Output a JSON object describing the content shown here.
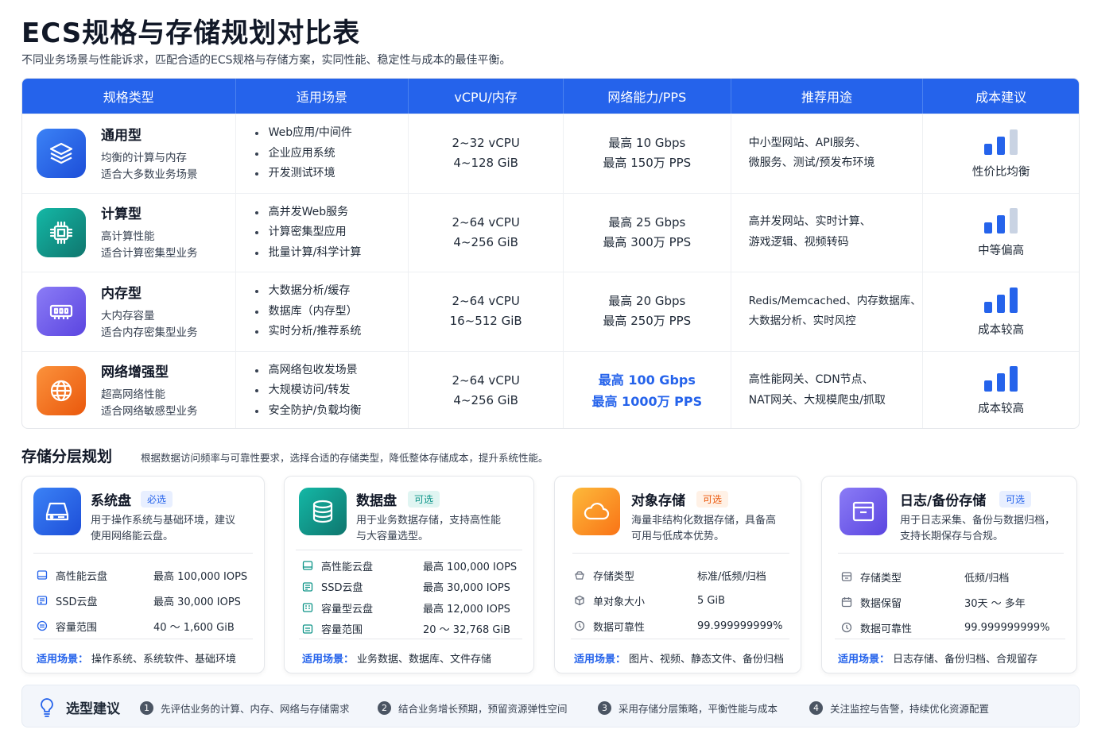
{
  "page": {
    "title": "ECS规格与存储规划对比表",
    "subtitle": "不同业务场景与性能诉求，匹配合适的ECS规格与存储方案，实同性能、稳定性与成本的最佳平衡。"
  },
  "spec_table": {
    "headers": [
      "规格类型",
      "适用场景",
      "vCPU/内存",
      "网络能力/PPS",
      "推荐用途",
      "成本建议"
    ],
    "rows": [
      {
        "name": "通用型",
        "desc": [
          "均衡的计算与内存",
          "适合大多数业务场景"
        ],
        "icon": "layers-icon",
        "icon_color": "#2563eb",
        "scenarios": [
          "Web应用/中间件",
          "企业应用系统",
          "开发测试环境"
        ],
        "cpu": "2~32 vCPU",
        "mem": "4~128 GiB",
        "net": "最高 10 Gbps",
        "pps": "最高 150万 PPS",
        "use": [
          "中小型网站、API服务、",
          "微服务、测试/预发布环境"
        ],
        "cost_level": 2,
        "cost_label": "性价比均衡"
      },
      {
        "name": "计算型",
        "desc": [
          "高计算性能",
          "适合计算密集型业务"
        ],
        "icon": "cpu-chip-icon",
        "icon_color": "#0d9488",
        "scenarios": [
          "高并发Web服务",
          "计算密集型应用",
          "批量计算/科学计算"
        ],
        "cpu": "2~64 vCPU",
        "mem": "4~256 GiB",
        "net": "最高 25 Gbps",
        "pps": "最高 300万 PPS",
        "use": [
          "高并发网站、实时计算、",
          "游戏逻辑、视频转码"
        ],
        "cost_level": 2,
        "cost_label": "中等偏高"
      },
      {
        "name": "内存型",
        "desc": [
          "大内存容量",
          "适合内存密集型业务"
        ],
        "icon": "memory-icon",
        "icon_color": "#6d5ce7",
        "scenarios": [
          "大数据分析/缓存",
          "数据库（内存型）",
          "实时分析/推荐系统"
        ],
        "cpu": "2~64 vCPU",
        "mem": "16~512 GiB",
        "net": "最高 20 Gbps",
        "pps": "最高 250万 PPS",
        "use": [
          "Redis/Memcached、内存数据库、",
          "大数据分析、实时风控"
        ],
        "cost_level": 3,
        "cost_label": "成本较高"
      },
      {
        "name": "网络增强型",
        "desc": [
          "超高网络性能",
          "适合网络敏感型业务"
        ],
        "icon": "globe-icon",
        "icon_color": "#f97316",
        "scenarios": [
          "高网络包收发场景",
          "大规模访问/转发",
          "安全防护/负载均衡"
        ],
        "cpu": "2~64 vCPU",
        "mem": "4~256 GiB",
        "net": "最高 100 Gbps",
        "pps": "最高 1000万 PPS",
        "net_highlight": true,
        "use": [
          "高性能网关、CDN节点、",
          "NAT网关、大规模爬虫/抓取"
        ],
        "cost_level": 3,
        "cost_label": "成本较高"
      }
    ]
  },
  "storage": {
    "title": "存储分层规划",
    "subtitle": "根据数据访问频率与可靠性要求，选择合适的存储类型，降低整体存储成本，提升系统性能。",
    "footer_label": "适用场景：",
    "cards": [
      {
        "name": "系统盘",
        "badge": "必选",
        "badge_color": "#2563eb",
        "icon": "hard-drive-icon",
        "icon_color": "#2563eb",
        "desc": [
          "用于操作系统与基础环境，建议",
          "使用网络能云盘。"
        ],
        "rows": [
          {
            "icon": "disk-icon",
            "label": "高性能云盘",
            "value": "最高 100,000 IOPS"
          },
          {
            "icon": "ssd-icon",
            "label": "SSD云盘",
            "value": "最高 30,000 IOPS"
          },
          {
            "icon": "range-icon",
            "label": "容量范围",
            "value": "40 ～ 1,600 GiB"
          }
        ],
        "footer": "操作系统、系统软件、基础环境"
      },
      {
        "name": "数据盘",
        "badge": "可选",
        "badge_color": "#0d9488",
        "icon": "database-icon",
        "icon_color": "#0d9488",
        "desc": [
          "用于业务数据存储，支持高性能",
          "与大容量选型。"
        ],
        "rows": [
          {
            "icon": "disk-icon",
            "label": "高性能云盘",
            "value": "最高 100,000 IOPS"
          },
          {
            "icon": "ssd-icon",
            "label": "SSD云盘",
            "value": "最高 30,000 IOPS"
          },
          {
            "icon": "capacity-icon",
            "label": "容量型云盘",
            "value": "最高 12,000 IOPS"
          },
          {
            "icon": "range-icon",
            "label": "容量范围",
            "value": "20 ～ 32,768 GiB"
          }
        ],
        "footer": "业务数据、数据库、文件存储"
      },
      {
        "name": "对象存储",
        "badge": "可选",
        "badge_color": "#f97316",
        "icon": "cloud-icon",
        "icon_color": "#f97316",
        "desc": [
          "海量非结构化数据存储，具备高",
          "可用与低成本优势。"
        ],
        "rows": [
          {
            "icon": "storage-type-icon",
            "label": "存储类型",
            "value": "标准/低频/归档"
          },
          {
            "icon": "object-size-icon",
            "label": "单对象大小",
            "value": "5 GiB"
          },
          {
            "icon": "reliability-icon",
            "label": "数据可靠性",
            "value": "99.999999999%"
          }
        ],
        "footer": "图片、视频、静态文件、备份归档"
      },
      {
        "name": "日志/备份存储",
        "badge": "可选",
        "badge_color": "#2563eb",
        "icon": "archive-icon",
        "icon_color": "#6d5ce7",
        "desc": [
          "用于日志采集、备份与数据归档，",
          "支持长期保存与合规。"
        ],
        "rows": [
          {
            "icon": "storage-type-icon",
            "label": "存储类型",
            "value": "低频/归档"
          },
          {
            "icon": "calendar-icon",
            "label": "数据保留",
            "value": "30天 ～ 多年"
          },
          {
            "icon": "reliability-icon",
            "label": "数据可靠性",
            "value": "99.999999999%"
          }
        ],
        "footer": "日志存储、备份归档、合规留存"
      }
    ]
  },
  "advice": {
    "title": "选型建议",
    "icon": "lightbulb-icon",
    "steps": [
      {
        "num": "1",
        "text": "先评估业务的计算、内存、网络与存储需求"
      },
      {
        "num": "2",
        "text": "结合业务增长预期，预留资源弹性空间"
      },
      {
        "num": "3",
        "text": "采用存储分层策略，平衡性能与成本"
      },
      {
        "num": "4",
        "text": "关注监控与告警，持续优化资源配置"
      }
    ]
  }
}
